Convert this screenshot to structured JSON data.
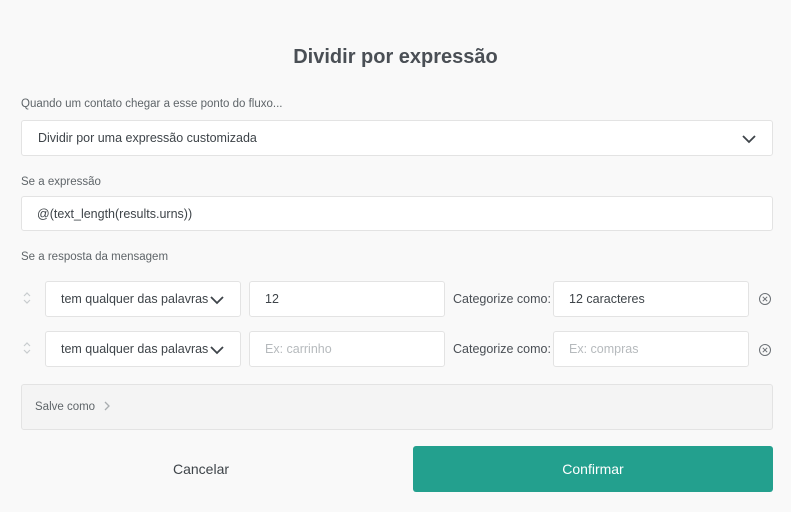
{
  "title": "Dividir por expressão",
  "trigger": {
    "label": "Quando um contato chegar a esse ponto do fluxo...",
    "selected": "Dividir por uma expressão customizada"
  },
  "expression": {
    "label": "Se a expressão",
    "value": "@(text_length(results.urns))"
  },
  "rules": {
    "label": "Se a resposta da mensagem",
    "categorize_label": "Categorize como:",
    "items": [
      {
        "operator": "tem qualquer das palavras",
        "value": "12",
        "value_placeholder": "",
        "category": "12 caracteres",
        "category_placeholder": ""
      },
      {
        "operator": "tem qualquer das palavras",
        "value": "",
        "value_placeholder": "Ex: carrinho",
        "category": "",
        "category_placeholder": "Ex: compras"
      }
    ]
  },
  "save_as": {
    "label": "Salve como"
  },
  "buttons": {
    "cancel": "Cancelar",
    "confirm": "Confirmar"
  },
  "colors": {
    "accent": "#23a08e",
    "background": "#f9f9f9"
  }
}
